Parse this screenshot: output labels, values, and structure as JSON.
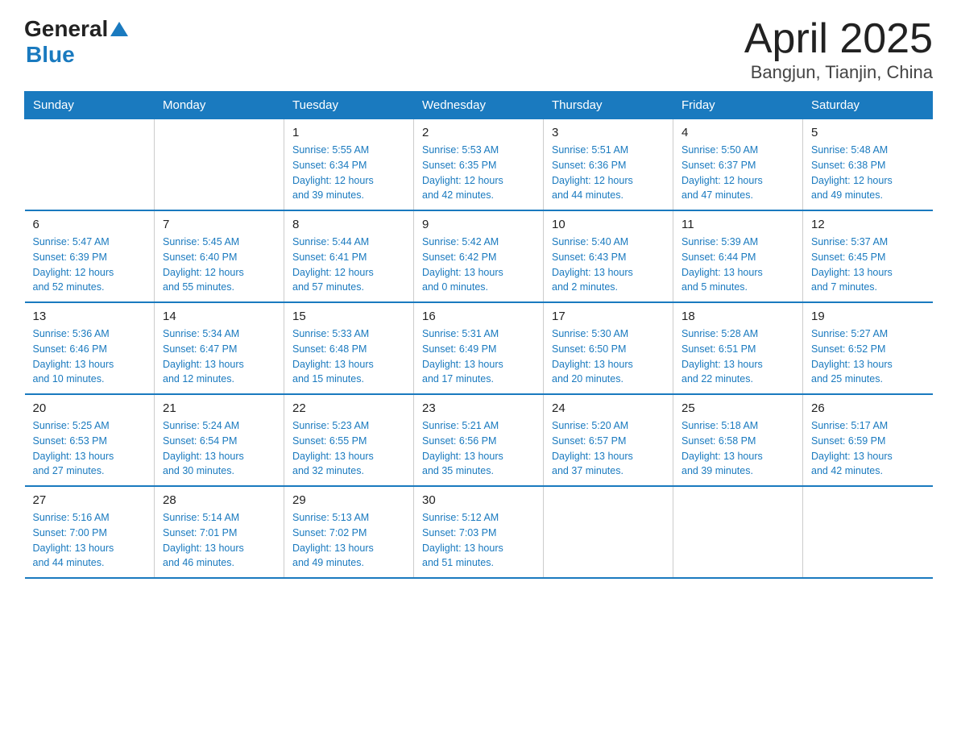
{
  "header": {
    "logo_general": "General",
    "logo_blue": "Blue",
    "title": "April 2025",
    "subtitle": "Bangjun, Tianjin, China"
  },
  "calendar": {
    "days_of_week": [
      "Sunday",
      "Monday",
      "Tuesday",
      "Wednesday",
      "Thursday",
      "Friday",
      "Saturday"
    ],
    "weeks": [
      [
        {
          "day": "",
          "info": ""
        },
        {
          "day": "",
          "info": ""
        },
        {
          "day": "1",
          "info": "Sunrise: 5:55 AM\nSunset: 6:34 PM\nDaylight: 12 hours\nand 39 minutes."
        },
        {
          "day": "2",
          "info": "Sunrise: 5:53 AM\nSunset: 6:35 PM\nDaylight: 12 hours\nand 42 minutes."
        },
        {
          "day": "3",
          "info": "Sunrise: 5:51 AM\nSunset: 6:36 PM\nDaylight: 12 hours\nand 44 minutes."
        },
        {
          "day": "4",
          "info": "Sunrise: 5:50 AM\nSunset: 6:37 PM\nDaylight: 12 hours\nand 47 minutes."
        },
        {
          "day": "5",
          "info": "Sunrise: 5:48 AM\nSunset: 6:38 PM\nDaylight: 12 hours\nand 49 minutes."
        }
      ],
      [
        {
          "day": "6",
          "info": "Sunrise: 5:47 AM\nSunset: 6:39 PM\nDaylight: 12 hours\nand 52 minutes."
        },
        {
          "day": "7",
          "info": "Sunrise: 5:45 AM\nSunset: 6:40 PM\nDaylight: 12 hours\nand 55 minutes."
        },
        {
          "day": "8",
          "info": "Sunrise: 5:44 AM\nSunset: 6:41 PM\nDaylight: 12 hours\nand 57 minutes."
        },
        {
          "day": "9",
          "info": "Sunrise: 5:42 AM\nSunset: 6:42 PM\nDaylight: 13 hours\nand 0 minutes."
        },
        {
          "day": "10",
          "info": "Sunrise: 5:40 AM\nSunset: 6:43 PM\nDaylight: 13 hours\nand 2 minutes."
        },
        {
          "day": "11",
          "info": "Sunrise: 5:39 AM\nSunset: 6:44 PM\nDaylight: 13 hours\nand 5 minutes."
        },
        {
          "day": "12",
          "info": "Sunrise: 5:37 AM\nSunset: 6:45 PM\nDaylight: 13 hours\nand 7 minutes."
        }
      ],
      [
        {
          "day": "13",
          "info": "Sunrise: 5:36 AM\nSunset: 6:46 PM\nDaylight: 13 hours\nand 10 minutes."
        },
        {
          "day": "14",
          "info": "Sunrise: 5:34 AM\nSunset: 6:47 PM\nDaylight: 13 hours\nand 12 minutes."
        },
        {
          "day": "15",
          "info": "Sunrise: 5:33 AM\nSunset: 6:48 PM\nDaylight: 13 hours\nand 15 minutes."
        },
        {
          "day": "16",
          "info": "Sunrise: 5:31 AM\nSunset: 6:49 PM\nDaylight: 13 hours\nand 17 minutes."
        },
        {
          "day": "17",
          "info": "Sunrise: 5:30 AM\nSunset: 6:50 PM\nDaylight: 13 hours\nand 20 minutes."
        },
        {
          "day": "18",
          "info": "Sunrise: 5:28 AM\nSunset: 6:51 PM\nDaylight: 13 hours\nand 22 minutes."
        },
        {
          "day": "19",
          "info": "Sunrise: 5:27 AM\nSunset: 6:52 PM\nDaylight: 13 hours\nand 25 minutes."
        }
      ],
      [
        {
          "day": "20",
          "info": "Sunrise: 5:25 AM\nSunset: 6:53 PM\nDaylight: 13 hours\nand 27 minutes."
        },
        {
          "day": "21",
          "info": "Sunrise: 5:24 AM\nSunset: 6:54 PM\nDaylight: 13 hours\nand 30 minutes."
        },
        {
          "day": "22",
          "info": "Sunrise: 5:23 AM\nSunset: 6:55 PM\nDaylight: 13 hours\nand 32 minutes."
        },
        {
          "day": "23",
          "info": "Sunrise: 5:21 AM\nSunset: 6:56 PM\nDaylight: 13 hours\nand 35 minutes."
        },
        {
          "day": "24",
          "info": "Sunrise: 5:20 AM\nSunset: 6:57 PM\nDaylight: 13 hours\nand 37 minutes."
        },
        {
          "day": "25",
          "info": "Sunrise: 5:18 AM\nSunset: 6:58 PM\nDaylight: 13 hours\nand 39 minutes."
        },
        {
          "day": "26",
          "info": "Sunrise: 5:17 AM\nSunset: 6:59 PM\nDaylight: 13 hours\nand 42 minutes."
        }
      ],
      [
        {
          "day": "27",
          "info": "Sunrise: 5:16 AM\nSunset: 7:00 PM\nDaylight: 13 hours\nand 44 minutes."
        },
        {
          "day": "28",
          "info": "Sunrise: 5:14 AM\nSunset: 7:01 PM\nDaylight: 13 hours\nand 46 minutes."
        },
        {
          "day": "29",
          "info": "Sunrise: 5:13 AM\nSunset: 7:02 PM\nDaylight: 13 hours\nand 49 minutes."
        },
        {
          "day": "30",
          "info": "Sunrise: 5:12 AM\nSunset: 7:03 PM\nDaylight: 13 hours\nand 51 minutes."
        },
        {
          "day": "",
          "info": ""
        },
        {
          "day": "",
          "info": ""
        },
        {
          "day": "",
          "info": ""
        }
      ]
    ]
  }
}
